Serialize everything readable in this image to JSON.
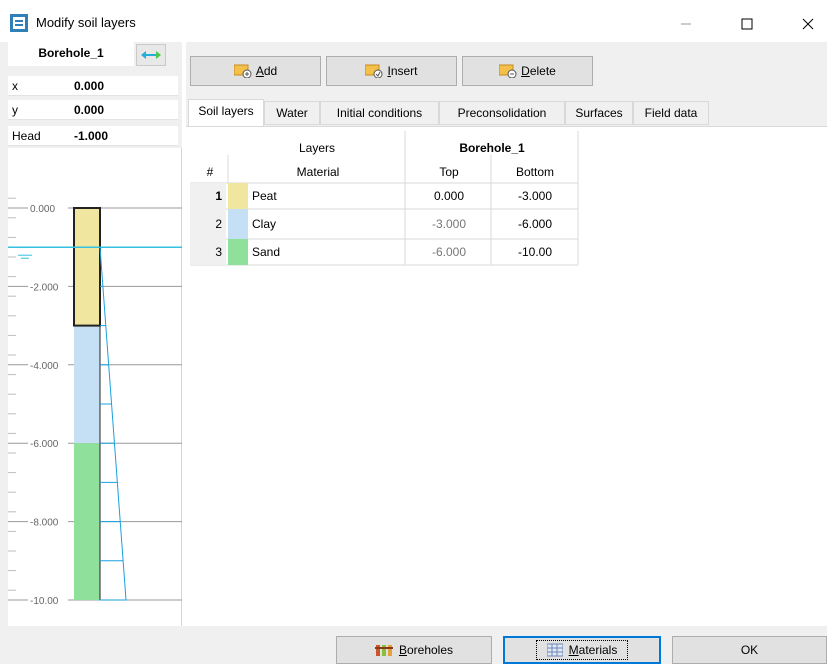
{
  "window": {
    "title": "Modify soil layers",
    "controls": {
      "minimize": "minimize-icon",
      "maximize": "maximize-icon",
      "close": "close-icon"
    }
  },
  "left_panel": {
    "borehole_name": "Borehole_1",
    "x_label": "x",
    "x_value": "0.000",
    "y_label": "y",
    "y_value": "0.000",
    "head_label": "Head",
    "head_value": "-1.000",
    "ruler_ticks": [
      "0.000",
      "-2.000",
      "-4.000",
      "-6.000",
      "-8.000",
      "-10.00"
    ],
    "water_level": -1.0,
    "axis_range": [
      0,
      -10
    ]
  },
  "toolbar": {
    "add_label": "Add",
    "insert_label": "Insert",
    "delete_label": "Delete"
  },
  "tabs": [
    {
      "label": "Soil layers",
      "active": true
    },
    {
      "label": "Water",
      "active": false
    },
    {
      "label": "Initial conditions",
      "active": false
    },
    {
      "label": "Preconsolidation",
      "active": false
    },
    {
      "label": "Surfaces",
      "active": false
    },
    {
      "label": "Field data",
      "active": false
    }
  ],
  "grid": {
    "header_layers": "Layers",
    "header_borehole": "Borehole_1",
    "col_num": "#",
    "col_material": "Material",
    "col_top": "Top",
    "col_bottom": "Bottom",
    "rows": [
      {
        "num": "1",
        "material": "Peat",
        "color": "#f0e6a0",
        "top": "0.000",
        "bottom": "-3.000",
        "top_val": 0,
        "bottom_val": -3
      },
      {
        "num": "2",
        "material": "Clay",
        "color": "#c5e0f5",
        "top": "-3.000",
        "bottom": "-6.000",
        "top_val": -3,
        "bottom_val": -6
      },
      {
        "num": "3",
        "material": "Sand",
        "color": "#8ee09a",
        "top": "-6.000",
        "bottom": "-10.00",
        "top_val": -6,
        "bottom_val": -10
      }
    ]
  },
  "footer": {
    "boreholes_label": "Boreholes",
    "materials_label": "Materials",
    "ok_label": "OK"
  },
  "colors": {
    "water_line": "#34c0e0",
    "pressure_line": "#1aa0e0",
    "focus_border": "#0078d7"
  }
}
